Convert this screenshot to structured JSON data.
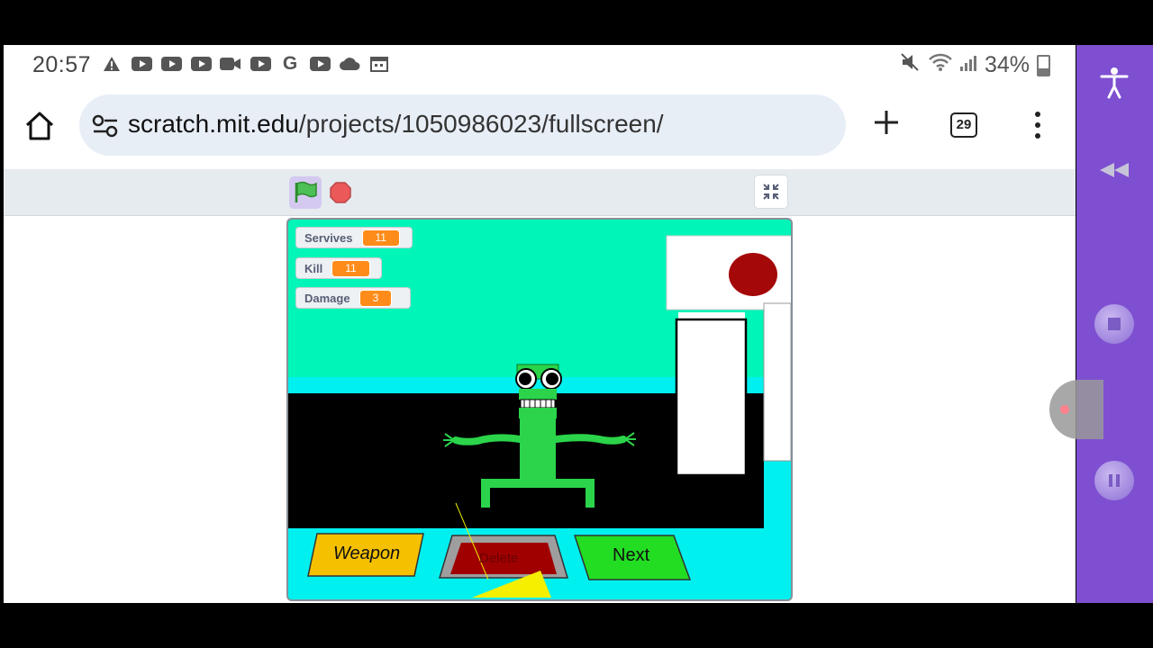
{
  "status_bar": {
    "time": "20:57",
    "notification_icons": [
      "alert-icon",
      "youtube-icon",
      "youtube-icon",
      "youtube-icon",
      "video-icon",
      "youtube-icon",
      "google-icon",
      "youtube-icon",
      "cloud-icon",
      "calendar-icon"
    ],
    "battery": "34%",
    "battery_level": 0.34
  },
  "browser": {
    "url_domain": "scratch.mit.edu",
    "url_path": "/projects/1050986023/fullscreen/",
    "tab_count": "29"
  },
  "scratch": {
    "variables": [
      {
        "name": "Servives",
        "value": "11"
      },
      {
        "name": "Kill",
        "value": "11"
      },
      {
        "name": "Damage",
        "value": "3"
      }
    ],
    "buttons": {
      "weapon": "Weapon",
      "delete": "Delete",
      "next": "Next"
    }
  },
  "colors": {
    "sky": "#00f5b9",
    "floor": "#00f0f0",
    "character": "#2bd44a",
    "accent_purple": "#7e4fd1"
  }
}
